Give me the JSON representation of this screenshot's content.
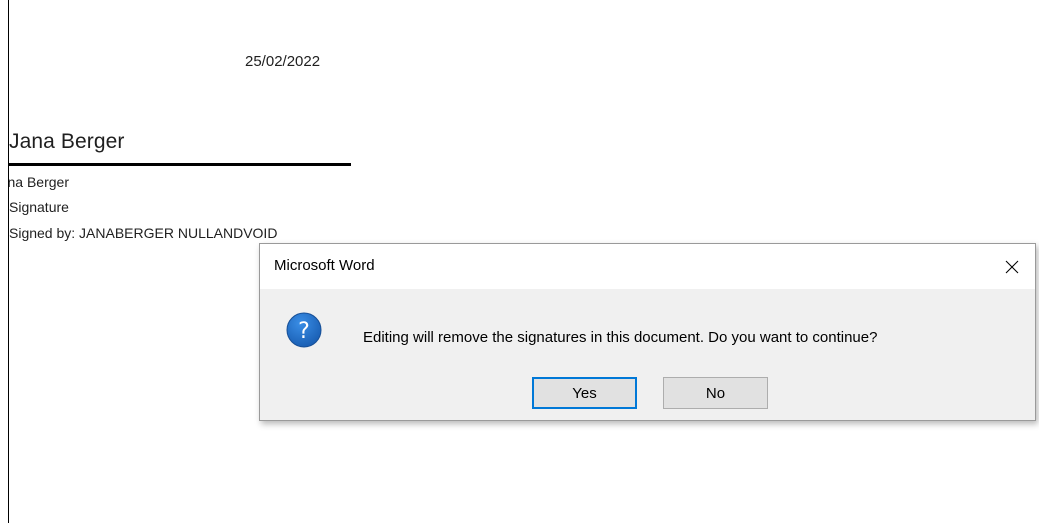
{
  "document": {
    "date": "25/02/2022",
    "signer_name": "Jana Berger",
    "signer_line_1": "Jana Berger",
    "signer_line_2": "Signature",
    "signer_line_3": "Signed by: JANABERGER NULLANDVOID"
  },
  "dialog": {
    "title": "Microsoft Word",
    "message": "Editing will remove the signatures in this document. Do you want to continue?",
    "icon": "question-icon",
    "close_icon": "close-icon",
    "buttons": {
      "yes": "Yes",
      "no": "No"
    },
    "accent_color": "#0078d7",
    "icon_color": "#1e6fc9"
  }
}
